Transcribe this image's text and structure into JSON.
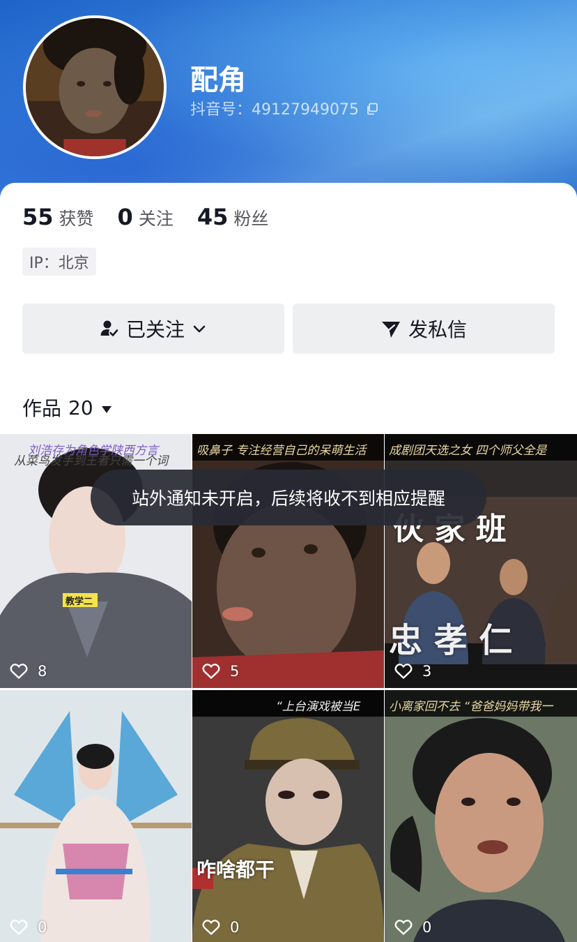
{
  "profile": {
    "name": "配角",
    "douyin_id_label": "抖音号：",
    "douyin_id": "49127949075"
  },
  "stats": [
    {
      "num": "55",
      "label": "获赞"
    },
    {
      "num": "0",
      "label": "关注"
    },
    {
      "num": "45",
      "label": "粉丝"
    }
  ],
  "ip": "IP：北京",
  "buttons": {
    "follow_label": "已关注",
    "message_label": "发私信"
  },
  "works": {
    "label": "作品",
    "count": "20"
  },
  "toast": "站外通知未开启，后续将收不到相应提醒",
  "videos": [
    {
      "caption": "刘浩存为角色学陕西方言",
      "caption2": "从菜鸟发手到王者只需一个词",
      "overlay": "教学二",
      "likes": "8"
    },
    {
      "caption": "吸鼻子  专注经营自己的呆萌生活",
      "likes": "5"
    },
    {
      "caption": "成剧团天选之女  四个师父全是",
      "overlay": "伙 家 班",
      "overlay2": "忠 孝 仁",
      "likes": "3"
    },
    {
      "likes": "0"
    },
    {
      "caption": "“上台演戏被当E",
      "overlay": "咋啥都干",
      "likes": "0"
    },
    {
      "caption": "小离家回不去  “爸爸妈妈带我一",
      "likes": "0"
    }
  ],
  "colors": {
    "header_blue": "#2a6fd0",
    "button_bg": "#eeeff1",
    "toast_bg": "#282a34"
  }
}
